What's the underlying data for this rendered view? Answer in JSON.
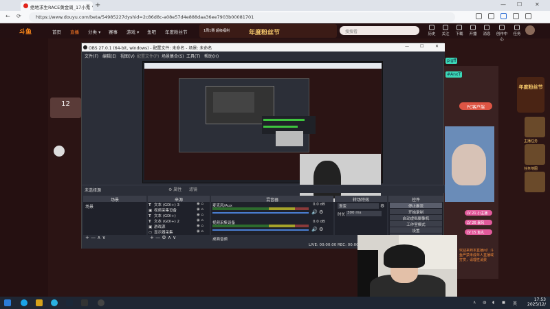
{
  "browser": {
    "tab_title": "绝地求生RACE黄金周_17小鬼 \"超",
    "url": "https://www.douyu.com/beta/54985227dyshid=2c86d8c-a08e57d4e888daa36ee7903b00081701",
    "new_tab": "+",
    "close": "×",
    "min": "—",
    "max": "☐",
    "winclose": "✕",
    "back": "←",
    "refresh": "⟳"
  },
  "douyu": {
    "logo": "斗鱼",
    "nav": [
      "首页",
      "直播",
      "分类 ▾",
      "赛事",
      "游戏 ▾",
      "鱼吧",
      "年度粉丝节"
    ],
    "promo": "1周1赛 超级福利",
    "banner_text": "年度粉丝节",
    "search_placeholder": "搜搜看",
    "header_icons": [
      "历史",
      "关注",
      "下载",
      "开播",
      "消息",
      "创作中心",
      "任务"
    ],
    "panel_number": "12",
    "right_badges": [
      "pigff",
      "#AnxT"
    ],
    "pc_button": "PC客户端",
    "chat_lines": [
      "LV 21 小主播",
      "LV 26 暴风",
      "LV 15 鱼丸"
    ],
    "year_badge": "年度粉丝节",
    "side_labels": [
      "主播任务",
      "任务地图"
    ],
    "chat_text": "欢迎来到本直播间！斗鱼严禁未成年人直播或打赏，请理性消费"
  },
  "obs": {
    "title": "OBS 27.0.1 (64-bit, windows) - 配置文件: 未命名 - 场景: 未命名",
    "menu": [
      "文件(F)",
      "编辑(E)",
      "视图(V)",
      "配置文件(P)",
      "场景集合(S)",
      "工具(T)",
      "帮助(H)"
    ],
    "not_selected": "未选择源",
    "props_btn": "⚙ 属性",
    "filters_btn": "滤镜",
    "dock_headers": [
      "场景",
      "来源",
      "混音器",
      "转场特效",
      "控件"
    ],
    "scene_item": "场景",
    "sources": [
      {
        "icon": "T",
        "name": "文本 (GDI+) 3"
      },
      {
        "icon": "▣",
        "name": "视频采集设备"
      },
      {
        "icon": "T",
        "name": "文本 (GDI+)"
      },
      {
        "icon": "T",
        "name": "文本 (GDI+) 2"
      },
      {
        "icon": "▣",
        "name": "游戏源"
      },
      {
        "icon": "▭",
        "name": "显示器采集"
      }
    ],
    "mixer": [
      {
        "label": "麦克风/Aux",
        "db": "0.0 dB"
      },
      {
        "label": "视频采集设备",
        "db": "0.0 dB"
      },
      {
        "label": "桌面音频",
        "db": "0.0 dB"
      }
    ],
    "transition_type": "渐变",
    "duration_label": "时长",
    "duration_value": "300 ms",
    "controls": [
      "停止推流",
      "开始录制",
      "启动虚拟摄像机",
      "工作室模式",
      "设置",
      "退出"
    ],
    "dock_foot": "+ —  ∧ ∨",
    "status": "LIVE: 00:00:00   REC: 00:00:00   CPU: 0.0%, 30.00 fps"
  },
  "taskbar": {
    "time": "17:53",
    "date": "2025/12/",
    "lang": "英"
  },
  "colors": {
    "douyu_orange": "#ff7b25",
    "obs_bg": "#2b2e38",
    "meter_green": "#3ec43e"
  }
}
